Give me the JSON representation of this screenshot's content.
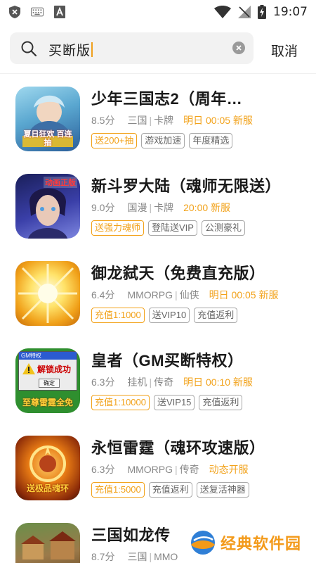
{
  "status_bar": {
    "time": "19:07",
    "left_icons": [
      "shield-icon",
      "keyboard-icon",
      "font-a-icon"
    ],
    "right_icons": [
      "wifi-icon",
      "no-signal-icon",
      "battery-charging-icon"
    ]
  },
  "search": {
    "query": "买断版",
    "cancel_label": "取消"
  },
  "colors": {
    "accent": "#f2a21a",
    "tag_border": "#a8a8a8",
    "meta_text": "#888888"
  },
  "games": [
    {
      "title": "少年三国志2（周年…",
      "score": "8.5分",
      "genre1": "三国",
      "genre2": "卡牌",
      "time": "明日 00:05 新服",
      "tags": [
        {
          "text": "送200+抽",
          "hot": true
        },
        {
          "text": "游戏加速",
          "hot": false
        },
        {
          "text": "年度精选",
          "hot": false
        }
      ],
      "icon_banner": "夏日狂欢 百连抽"
    },
    {
      "title": "新斗罗大陆（魂师无限送）",
      "score": "9.0分",
      "genre1": "国漫",
      "genre2": "卡牌",
      "time": "20:00 新服",
      "tags": [
        {
          "text": "送强力魂师",
          "hot": true
        },
        {
          "text": "登陆送VIP",
          "hot": false
        },
        {
          "text": "公测豪礼",
          "hot": false
        }
      ],
      "icon_banner": "动画正版"
    },
    {
      "title": "御龙弑天（免费直充版）",
      "score": "6.4分",
      "genre1": "MMORPG",
      "genre2": "仙侠",
      "time": "明日 00:05 新服",
      "tags": [
        {
          "text": "充值1:1000",
          "hot": true
        },
        {
          "text": "送VIP10",
          "hot": false
        },
        {
          "text": "充值返利",
          "hot": false
        }
      ],
      "icon_banner": ""
    },
    {
      "title": "皇者（GM买断特权）",
      "score": "6.3分",
      "genre1": "挂机",
      "genre2": "传奇",
      "time": "明日 00:10 新服",
      "tags": [
        {
          "text": "充值1:10000",
          "hot": true
        },
        {
          "text": "送VIP15",
          "hot": false
        },
        {
          "text": "充值返利",
          "hot": false
        }
      ],
      "icon_banner": "解锁成功",
      "icon_header": "GM特权",
      "icon_button": "确定",
      "icon_footer": "至尊雷霆全免"
    },
    {
      "title": "永恒雷霆（魂环攻速版）",
      "score": "6.3分",
      "genre1": "MMORPG",
      "genre2": "传奇",
      "time": "动态开服",
      "tags": [
        {
          "text": "充值1:5000",
          "hot": true
        },
        {
          "text": "充值返利",
          "hot": false
        },
        {
          "text": "送复活神器",
          "hot": false
        }
      ],
      "icon_banner": "送极品魂环"
    },
    {
      "title": "三国如龙传",
      "score": "8.7分",
      "genre1": "三国",
      "genre2": "MMO",
      "time": "",
      "tags": [],
      "icon_banner": ""
    }
  ],
  "watermark": {
    "text": "经典软件园"
  }
}
